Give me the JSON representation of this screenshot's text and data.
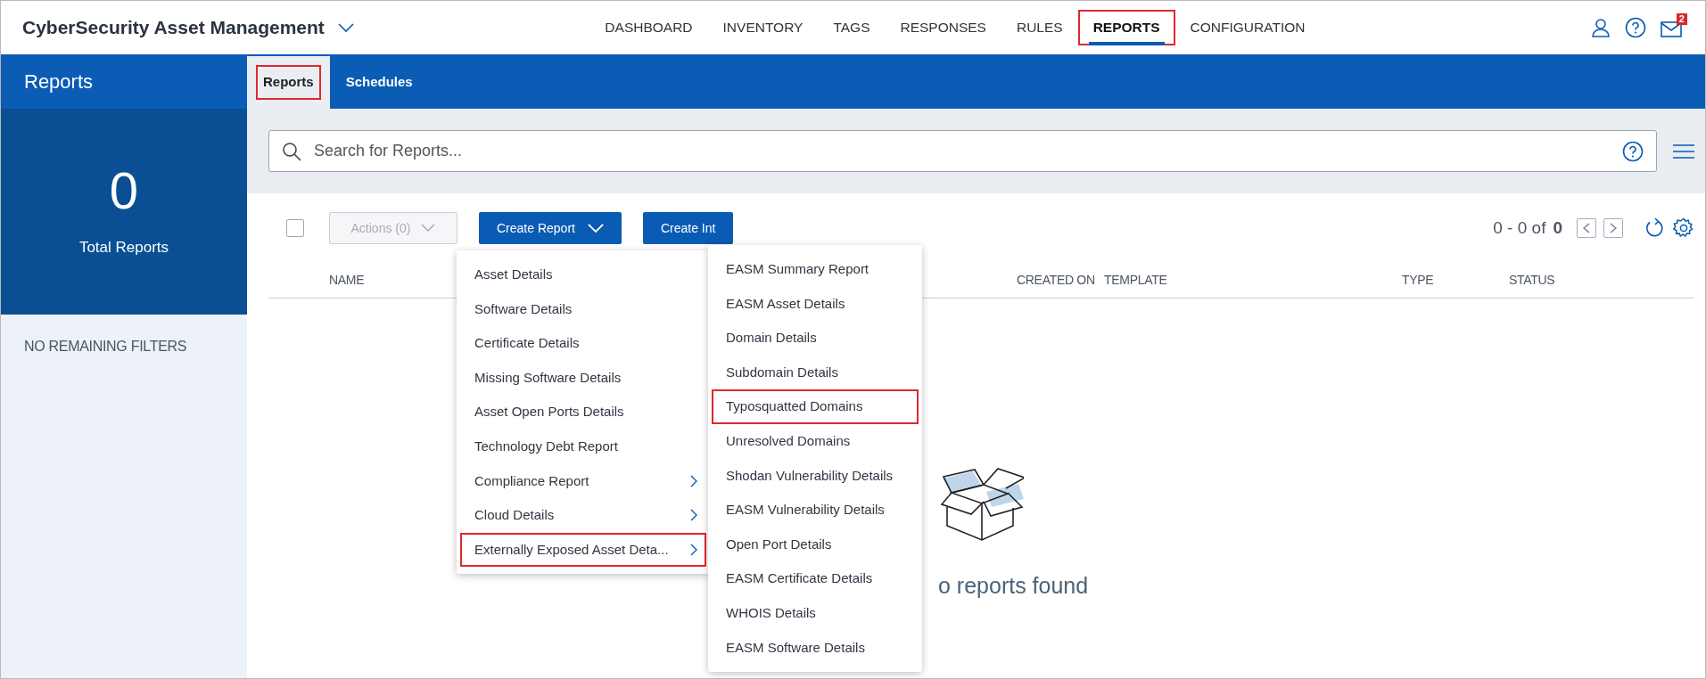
{
  "app": {
    "title": "CyberSecurity Asset Management",
    "mail_count": "2"
  },
  "nav": [
    {
      "label": "DASHBOARD",
      "selected": false,
      "highlighted": false
    },
    {
      "label": "INVENTORY",
      "selected": false,
      "highlighted": false
    },
    {
      "label": "TAGS",
      "selected": false,
      "highlighted": false
    },
    {
      "label": "RESPONSES",
      "selected": false,
      "highlighted": false
    },
    {
      "label": "RULES",
      "selected": false,
      "highlighted": false
    },
    {
      "label": "REPORTS",
      "selected": true,
      "highlighted": true
    },
    {
      "label": "CONFIGURATION",
      "selected": false,
      "highlighted": false
    }
  ],
  "sidebar": {
    "title": "Reports",
    "total": "0",
    "total_label": "Total Reports",
    "filters_note": "NO REMAINING FILTERS"
  },
  "tabs": [
    {
      "label": "Reports",
      "selected": true,
      "highlighted": true
    },
    {
      "label": "Schedules",
      "selected": false,
      "highlighted": false
    }
  ],
  "search": {
    "placeholder": "Search for Reports..."
  },
  "toolbar": {
    "select_all_checked": false,
    "actions": "Actions (0)",
    "create": "Create Report",
    "create_interactive": "Create Int",
    "range": "0 - 0 of",
    "total": "0"
  },
  "table": {
    "columns": [
      "NAME",
      "CREATED ON",
      "TEMPLATE",
      "TYPE",
      "STATUS"
    ],
    "empty_text": "o reports found"
  },
  "menu": [
    {
      "label": "Asset Details",
      "has_submenu": false,
      "highlighted": false
    },
    {
      "label": "Software Details",
      "has_submenu": false,
      "highlighted": false
    },
    {
      "label": "Certificate Details",
      "has_submenu": false,
      "highlighted": false
    },
    {
      "label": "Missing Software Details",
      "has_submenu": false,
      "highlighted": false
    },
    {
      "label": "Asset Open Ports Details",
      "has_submenu": false,
      "highlighted": false
    },
    {
      "label": "Technology Debt Report",
      "has_submenu": false,
      "highlighted": false
    },
    {
      "label": "Compliance Report",
      "has_submenu": true,
      "highlighted": false
    },
    {
      "label": "Cloud Details",
      "has_submenu": true,
      "highlighted": false
    },
    {
      "label": "Externally Exposed Asset Deta...",
      "has_submenu": true,
      "highlighted": true
    }
  ],
  "submenu": [
    {
      "label": "EASM Summary Report",
      "highlighted": false
    },
    {
      "label": "EASM Asset Details",
      "highlighted": false
    },
    {
      "label": "Domain Details",
      "highlighted": false
    },
    {
      "label": "Subdomain Details",
      "highlighted": false
    },
    {
      "label": "Typosquatted Domains",
      "highlighted": true
    },
    {
      "label": "Unresolved Domains",
      "highlighted": false
    },
    {
      "label": "Shodan Vulnerability Details",
      "highlighted": false
    },
    {
      "label": "EASM Vulnerability Details",
      "highlighted": false
    },
    {
      "label": "Open Port Details",
      "highlighted": false
    },
    {
      "label": "EASM Certificate Details",
      "highlighted": false
    },
    {
      "label": "WHOIS Details",
      "highlighted": false
    },
    {
      "label": "EASM Software Details",
      "highlighted": false
    }
  ]
}
